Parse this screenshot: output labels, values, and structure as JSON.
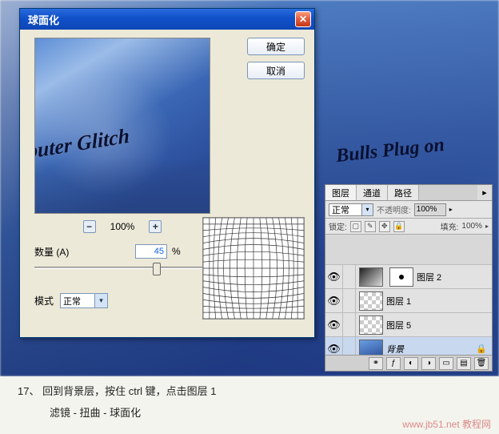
{
  "dialog": {
    "title": "球面化",
    "ok": "确定",
    "cancel": "取消",
    "zoom_percent": "100%",
    "amount_label": "数量 (A)",
    "amount_value": "45",
    "amount_unit": "%",
    "mode_label": "模式",
    "mode_value": "正常",
    "preview_headline": "nputer Glitch"
  },
  "background": {
    "headline2": "Bulls Plug on"
  },
  "layers_panel": {
    "tabs": {
      "layers": "图层",
      "channels": "通道",
      "paths": "路径"
    },
    "blend_mode": "正常",
    "opacity_label": "不透明度:",
    "opacity_value": "100%",
    "lock_label": "锁定:",
    "fill_label": "填充:",
    "fill_value": "100%",
    "layers": [
      {
        "name": "图层 2",
        "visible": true,
        "thumb": "grad_mask"
      },
      {
        "name": "图层 1",
        "visible": true,
        "thumb": "check"
      },
      {
        "name": "图层 5",
        "visible": true,
        "thumb": "check"
      },
      {
        "name": "背景",
        "visible": true,
        "thumb": "bg",
        "locked": true,
        "italic": true
      }
    ]
  },
  "caption": {
    "step_num": "17、",
    "line1_rest": "回到背景层，按住 ctrl 键，点击图层 1",
    "line2": "滤镜 - 扭曲 - 球面化"
  },
  "watermark": "www.jb51.net 教程网",
  "chart_data": {
    "type": "area",
    "title": "球面化",
    "xlabel": "数量",
    "ylabel": "",
    "values": [
      45
    ],
    "categories": [
      "amount_percent"
    ],
    "ylim": [
      -100,
      100
    ]
  }
}
